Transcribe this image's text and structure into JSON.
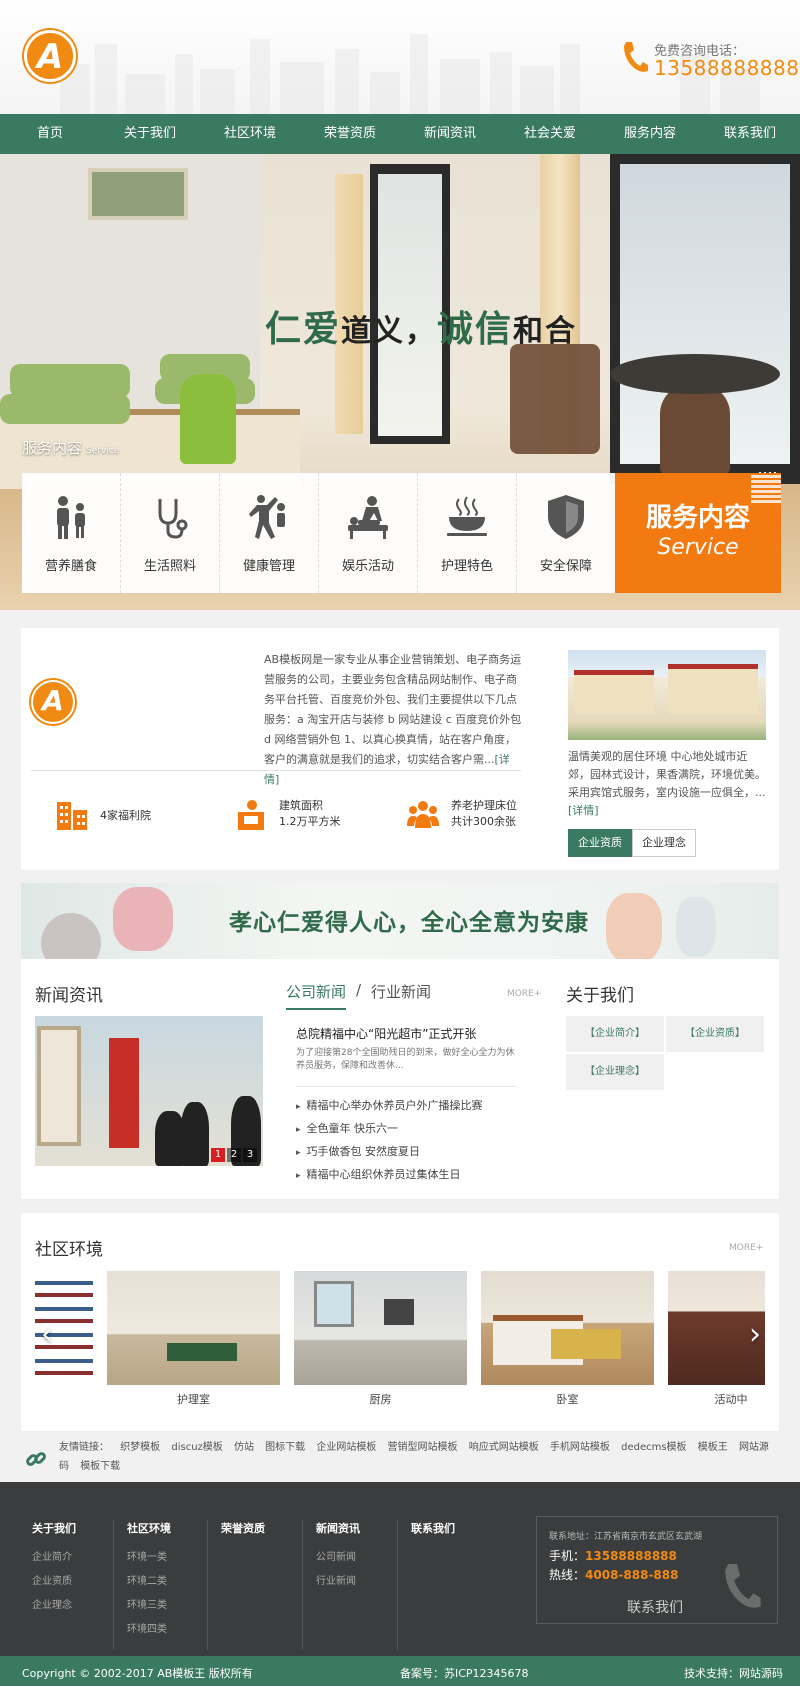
{
  "header": {
    "logo_text": "A",
    "phone_label": "免费咨询电话：",
    "phone_number": "13588888888"
  },
  "nav": [
    "首页",
    "关于我们",
    "社区环境",
    "荣誉资质",
    "新闻资讯",
    "社会关爱",
    "服务内容",
    "联系我们"
  ],
  "banner": {
    "slogan_a": "仁爱",
    "slogan_b": "道义，",
    "slogan_c": "诚信",
    "slogan_d": "和合",
    "section_title": "服务内容",
    "section_title_en": "Service"
  },
  "services": {
    "items": [
      {
        "label": "营养膳食",
        "icon": "family-icon"
      },
      {
        "label": "生活照料",
        "icon": "stethoscope-icon"
      },
      {
        "label": "健康管理",
        "icon": "exercise-icon"
      },
      {
        "label": "娱乐活动",
        "icon": "massage-icon"
      },
      {
        "label": "护理特色",
        "icon": "food-bowl-icon"
      },
      {
        "label": "安全保障",
        "icon": "shield-icon"
      }
    ],
    "badge_cn": "服务内容",
    "badge_en": "Service"
  },
  "about": {
    "text": "AB模板网是一家专业从事企业营销策划、电子商务运营服务的公司，主要业务包含精品网站制作、电子商务平台托管、百度竞价外包、我们主要提供以下几点服务：a 淘宝开店与装修 b 网站建设 c 百度竞价外包 d 网络营销外包 1、以真心换真情，站在客户角度，客户的满意就是我们的追求，切实结合客户需...",
    "more": "[详情]",
    "stats": [
      {
        "line1": "4家福利院",
        "line2": "",
        "icon": "building-icon"
      },
      {
        "line1": "建筑面积",
        "line2": "1.2万平方米",
        "icon": "nurse-desk-icon"
      },
      {
        "line1": "养老护理床位",
        "line2": "共计300余张",
        "icon": "group-icon"
      }
    ],
    "side_text": "温情美观的居住环境 中心地处城市近郊，园林式设计，果香满院，环境优美。采用宾馆式服务，室内设施一应俱全，...",
    "side_more": "[详情]",
    "tabs": [
      "企业资质",
      "企业理念"
    ]
  },
  "ad": {
    "text": "孝心仁爱得人心，全心全意为安康"
  },
  "news": {
    "title": "新闻资讯",
    "slider_pages": [
      "1",
      "2",
      "3"
    ],
    "tabs": [
      "公司新闻",
      "行业新闻"
    ],
    "tab_sep": "/",
    "more": "MORE+",
    "headline": "总院精福中心“阳光超市”正式开张",
    "headline_desc": "为了迎接第28个全国助残日的到来，做好全心全力为休养员服务，保障和改善休...",
    "items": [
      "精福中心举办休养员户外广播操比赛",
      "全色童年 快乐六一",
      "巧手做香包 安然度夏日",
      "精福中心组织休养员过集体生日"
    ]
  },
  "about_us": {
    "title": "关于我们",
    "links": [
      "【企业简介】",
      "【企业资质】",
      "【企业理念】"
    ]
  },
  "community": {
    "title": "社区环境",
    "more": "MORE+",
    "items": [
      "护理室",
      "厨房",
      "卧室",
      "活动中"
    ],
    "prev": "‹",
    "next": "›"
  },
  "friend_links": {
    "label": "友情链接：",
    "items": [
      "织梦模板",
      "discuz模板",
      "仿站",
      "图标下载",
      "企业网站模板",
      "营销型网站模板",
      "响应式网站模板",
      "手机网站模板",
      "dedecms模板",
      "模板王",
      "网站源码",
      "模板下载"
    ]
  },
  "footer": {
    "columns": [
      {
        "title": "关于我们",
        "items": [
          "企业简介",
          "企业资质",
          "企业理念"
        ]
      },
      {
        "title": "社区环境",
        "items": [
          "环境一类",
          "环境二类",
          "环境三类",
          "环境四类"
        ]
      },
      {
        "title": "荣誉资质",
        "items": []
      },
      {
        "title": "新闻资讯",
        "items": [
          "公司新闻",
          "行业新闻"
        ]
      },
      {
        "title": "联系我们",
        "items": []
      }
    ],
    "address": "联系地址：江苏省南京市玄武区玄武湖",
    "mobile_label": "手机：",
    "mobile": "13588888888",
    "hotline_label": "热线：",
    "hotline": "4008-888-888",
    "cta": "联系我们"
  },
  "bottom": {
    "copyright": "Copyright © 2002-2017 AB模板王 版权所有",
    "icp": "备案号：苏ICP12345678",
    "support": "技术支持：网站源码"
  },
  "colors": {
    "brand_green": "#3b7a62",
    "accent_orange": "#f27a10",
    "footer_dark": "#3a3c3d"
  }
}
